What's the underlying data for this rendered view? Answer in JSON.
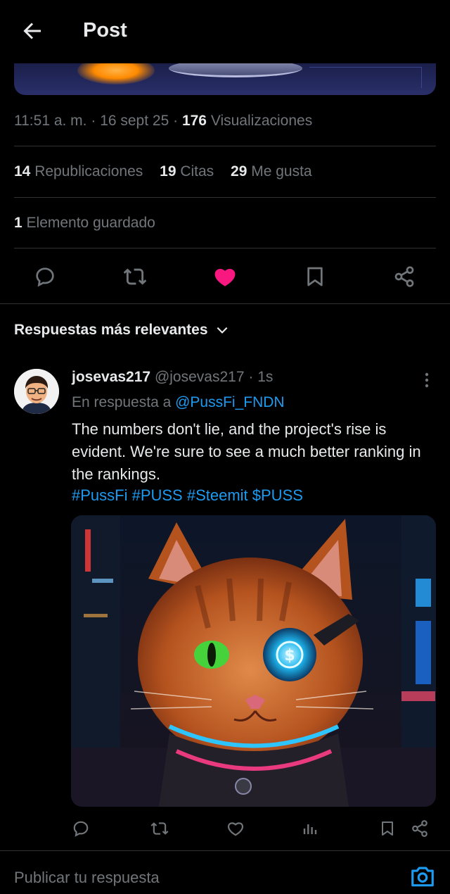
{
  "header": {
    "title": "Post"
  },
  "post": {
    "meta": {
      "time": "11:51 a. m.",
      "sep1": " · ",
      "date": "16 sept 25",
      "sep2": " · ",
      "views_count": "176",
      "views_label": " Visualizaciones"
    },
    "stats": [
      {
        "count": "14",
        "label": " Republicaciones"
      },
      {
        "count": "19",
        "label": " Citas"
      },
      {
        "count": "29",
        "label": " Me gusta"
      }
    ],
    "saved": {
      "count": "1",
      "label": " Elemento guardado"
    },
    "liked": true
  },
  "replies": {
    "sort_label": "Respuestas más relevantes",
    "items": [
      {
        "name": "josevas217",
        "handle": " @josevas217",
        "sep": " · ",
        "time": "1s",
        "in_reply_prefix": "En respuesta a ",
        "in_reply_mention": "@PussFi_FNDN",
        "text": "The numbers don't lie, and the project's rise is evident. We're sure to see a much better ranking in the rankings.",
        "hashtags": "#PussFi #PUSS #Steemit $PUSS"
      }
    ]
  },
  "composer": {
    "placeholder": "Publicar tu respuesta"
  },
  "colors": {
    "accent": "#1d9bf0",
    "like": "#f91880",
    "muted": "#71767b",
    "text": "#e7e9ea",
    "divider": "#2f3336"
  },
  "icons": [
    "arrow-left-icon",
    "reply-icon",
    "repost-icon",
    "heart-filled-icon",
    "bookmark-icon",
    "share-icon",
    "chevron-down-icon",
    "more-vertical-icon",
    "heart-outline-icon",
    "views-icon",
    "camera-icon"
  ]
}
